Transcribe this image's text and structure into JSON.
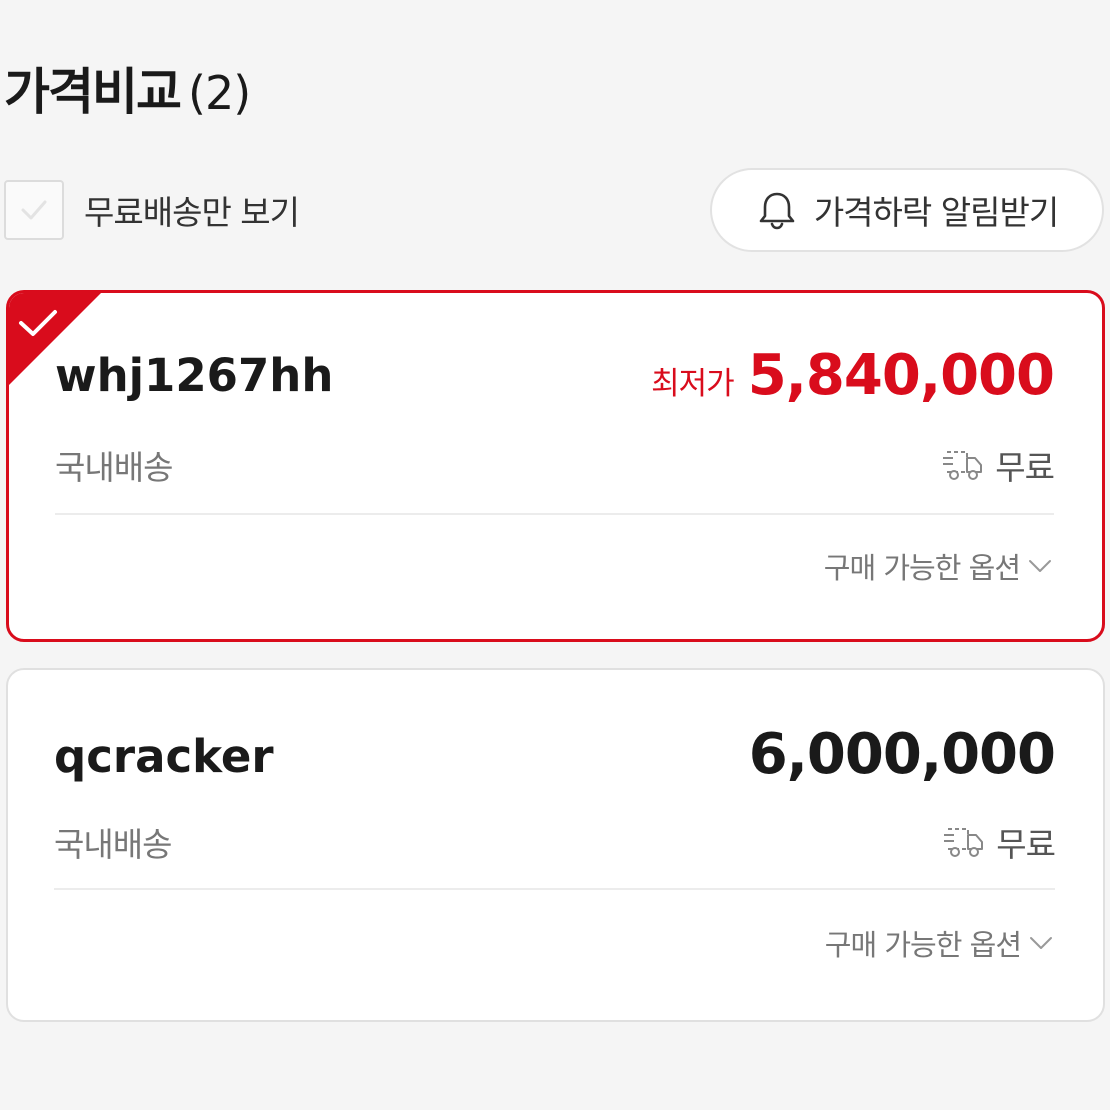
{
  "header": {
    "title": "가격비교",
    "count": "(2)"
  },
  "filter": {
    "free_shipping_label": "무료배송만 보기",
    "free_shipping_checked": false
  },
  "alert_button": {
    "label": "가격하락 알림받기"
  },
  "colors": {
    "accent": "#d90c1c",
    "text": "#1a1a1a",
    "muted": "#777777",
    "border": "#e0e0e0"
  },
  "offers": [
    {
      "seller": "whj1267hh",
      "lowest_label": "최저가",
      "price": "5,840,000",
      "shipping_type": "국내배송",
      "shipping_fee": "무료",
      "options_label": "구매 가능한 옵션",
      "selected": true
    },
    {
      "seller": "qcracker",
      "price": "6,000,000",
      "shipping_type": "국내배송",
      "shipping_fee": "무료",
      "options_label": "구매 가능한 옵션",
      "selected": false
    }
  ],
  "icons": {
    "checkbox": "check-icon",
    "bell": "bell-icon",
    "truck": "truck-icon",
    "chevron": "chevron-down-icon",
    "selected_corner": "check-icon"
  }
}
